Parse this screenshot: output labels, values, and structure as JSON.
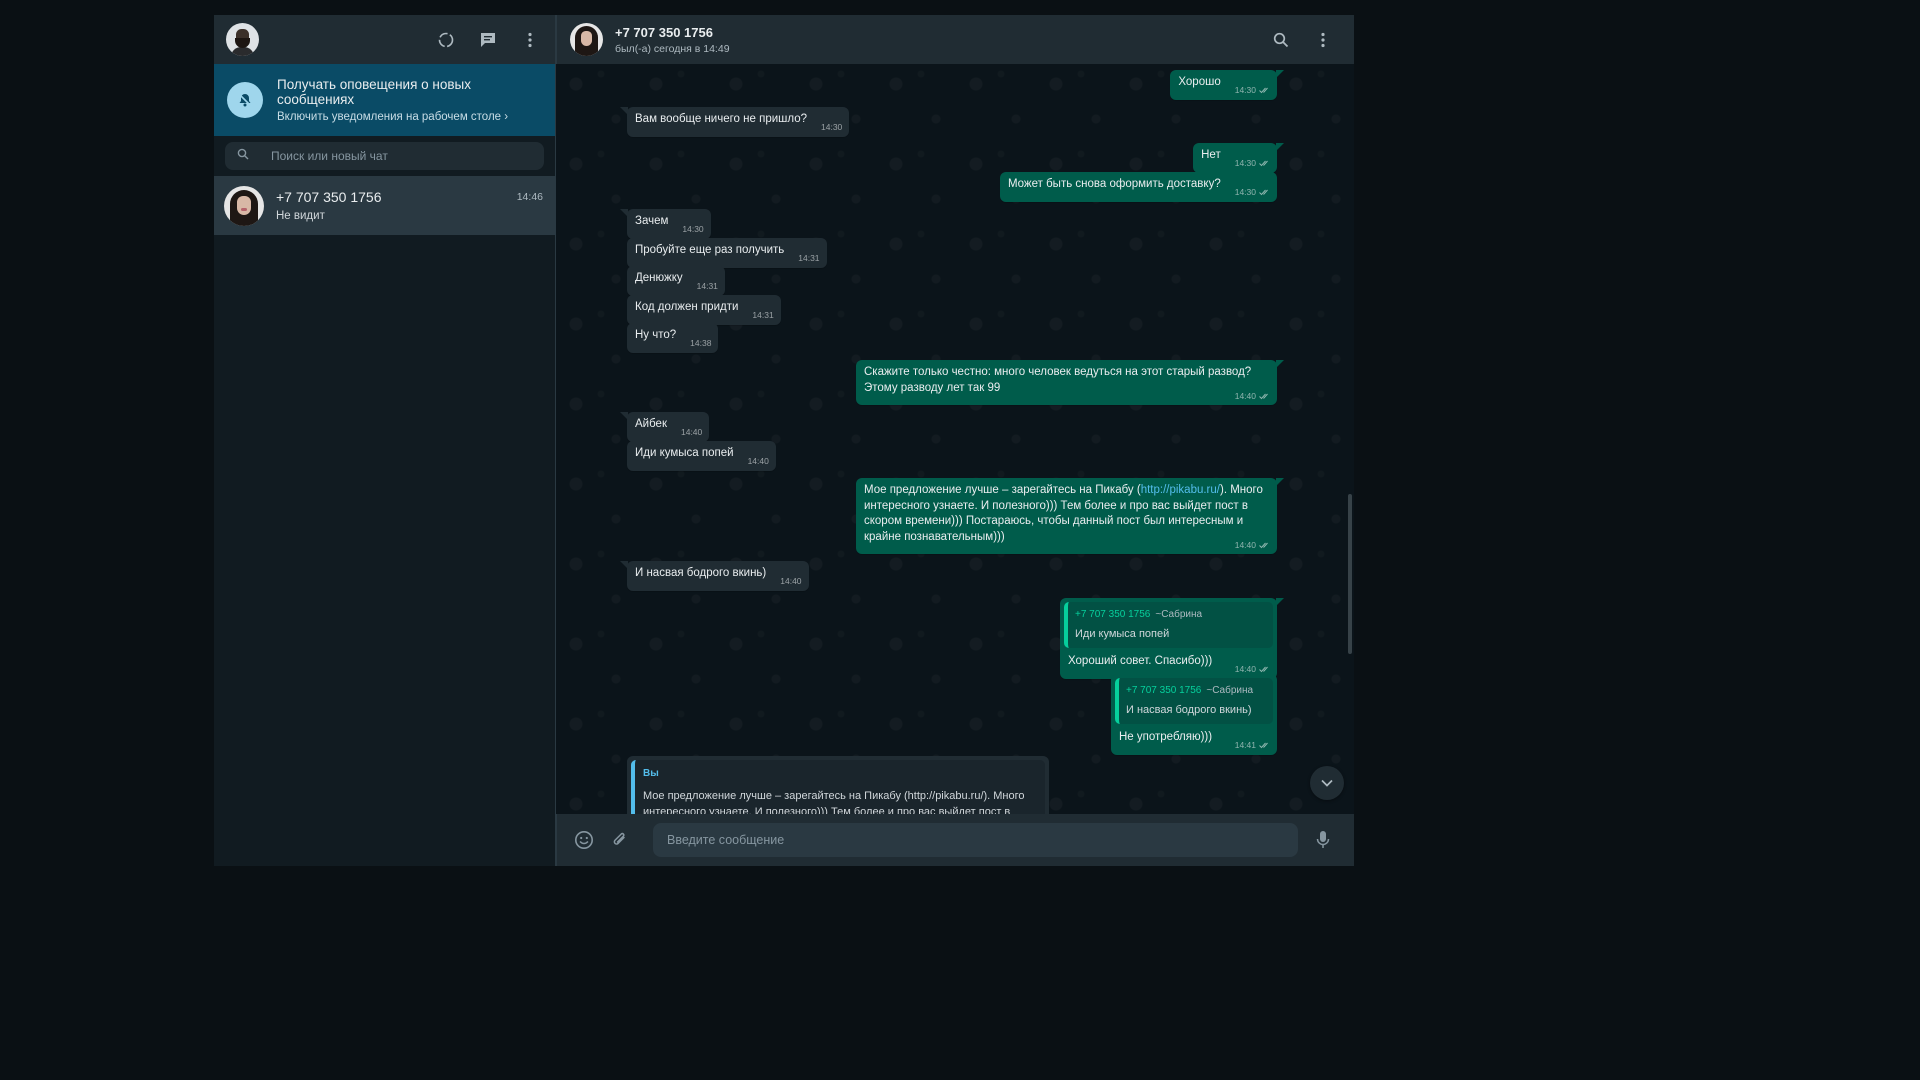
{
  "sidebar": {
    "notification": {
      "title": "Получать оповещения о новых сообщениях",
      "subtitle": "Включить уведомления на рабочем столе ›"
    },
    "search_placeholder": "Поиск или новый чат",
    "chats": [
      {
        "name": "+7 707 350 1756",
        "time": "14:46",
        "last_message": "Не видит"
      }
    ]
  },
  "chat": {
    "contact_name": "+7 707 350 1756",
    "status": "был(-а) сегодня в 14:49",
    "composer_placeholder": "Введите сообщение",
    "messages": [
      {
        "dir": "out",
        "text": "Хорошо",
        "time": "14:30"
      },
      {
        "dir": "in",
        "text": "Вам вообще ничего не пришло?",
        "time": "14:30"
      },
      {
        "dir": "out",
        "text": "Нет",
        "time": "14:30"
      },
      {
        "dir": "out",
        "text": "Может быть снова оформить доставку?",
        "time": "14:30"
      },
      {
        "dir": "in",
        "text": "Зачем",
        "time": "14:30"
      },
      {
        "dir": "in",
        "text": "Пробуйте еще раз получить",
        "time": "14:31"
      },
      {
        "dir": "in",
        "text": "Денюжку",
        "time": "14:31"
      },
      {
        "dir": "in",
        "text": "Код должен придти",
        "time": "14:31"
      },
      {
        "dir": "in",
        "text": "Ну что?",
        "time": "14:38"
      },
      {
        "dir": "out",
        "text": "Скажите только честно: много человек ведуться на этот старый развод?\nЭтому разводу лет так 99",
        "time": "14:40"
      },
      {
        "dir": "in",
        "text": "Айбек",
        "time": "14:40"
      },
      {
        "dir": "in",
        "text": "Иди кумыса попей",
        "time": "14:40"
      },
      {
        "dir": "out",
        "text_before": "Мое предложение лучше – зарегайтесь на Пикабу (",
        "link": "http://pikabu.ru/",
        "text_after": "). Много интересного узнаете. И полезного))) Тем более и про вас выйдет пост в скором времени))) Постараюсь, чтобы данный пост был интересным и крайне познавательным)))",
        "time": "14:40"
      },
      {
        "dir": "in",
        "text": "И насвая бодрого вкинь)",
        "time": "14:40"
      },
      {
        "dir": "out",
        "quote_name": "+7 707 350 1756",
        "quote_sub": "~Сабрина",
        "quote_text": "Иди кумыса попей",
        "text": "Хороший совет. Спасибо)))",
        "time": "14:40"
      },
      {
        "dir": "out",
        "quote_name": "+7 707 350 1756",
        "quote_sub": "~Сабрина",
        "quote_text": "И насвая бодрого вкинь)",
        "text": "Не употребляю)))",
        "time": "14:41"
      },
      {
        "dir": "in",
        "quote_name": "Вы",
        "quote_text": "Мое предложение лучше – зарегайтесь на Пикабу (http://pikabu.ru/). Много интересного узнаете. И полезного))) Тем более и про вас выйдет пост в скором времени))) Постараюсь, чтобы данный пост был интересным и крайне познавательным)))"
      }
    ]
  },
  "colors": {
    "outgoing_bubble": "#005c4b",
    "incoming_bubble": "#202c33",
    "panel": "#202c33",
    "notification_banner": "#0a4b66",
    "accent": "#06cf9c",
    "link": "#53bdeb"
  },
  "icons": {
    "header_left": [
      "status-icon",
      "new-chat-icon",
      "menu-icon"
    ],
    "header_right": [
      "search-icon",
      "menu-icon"
    ],
    "composer": [
      "emoji-icon",
      "attach-icon",
      "mic-icon"
    ],
    "notification": "bell-off-icon",
    "scroll": "chevron-down-icon"
  }
}
